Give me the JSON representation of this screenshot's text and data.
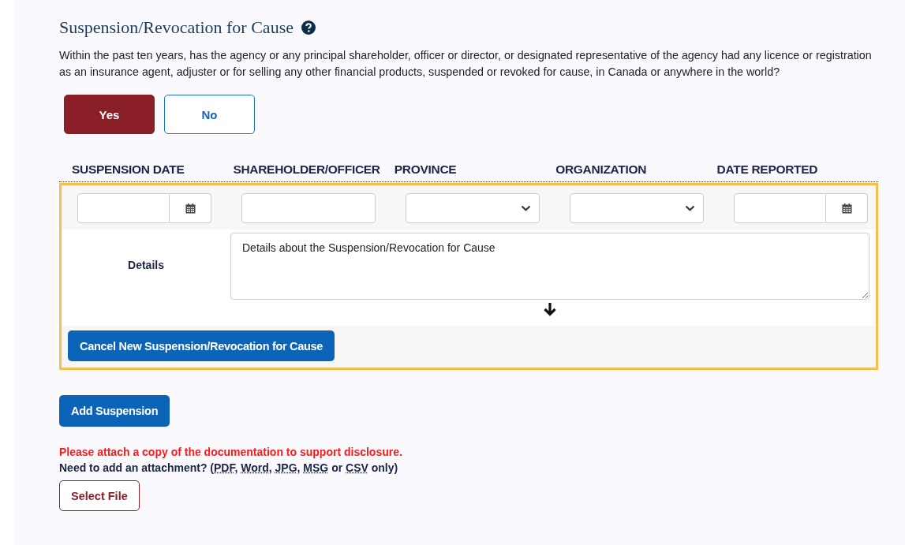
{
  "section": {
    "title": "Suspension/Revocation for Cause",
    "question": "Within the past ten years, has the agency or any principal shareholder, officer or director, or designated representative of the agency had any licence or registration as an insurance agent, adjuster or for selling any other financial products, suspended or revoked for cause, in Canada or anywhere in the world?"
  },
  "answers": [
    {
      "label": "Yes",
      "selected": true
    },
    {
      "label": "No",
      "selected": false
    }
  ],
  "table": {
    "columns": [
      {
        "heading": "SUSPENSION DATE",
        "kind": "date"
      },
      {
        "heading": "SHAREHOLDER/OFFICER",
        "kind": "text"
      },
      {
        "heading": "PROVINCE",
        "kind": "select"
      },
      {
        "heading": "ORGANIZATION",
        "kind": "select"
      },
      {
        "heading": "DATE REPORTED",
        "kind": "date"
      }
    ],
    "details_label": "Details",
    "details_value": "Details about the Suspension/Revocation for Cause",
    "cancel_button": "Cancel New Suspension/Revocation for Cause"
  },
  "add_button": "Add Suspension",
  "warning": "Please attach a copy of the documentation to support disclosure.",
  "attachment_note": [
    {
      "text": "Need to add an attachment? (",
      "abbr": false
    },
    {
      "text": "PDF",
      "abbr": true
    },
    {
      "text": ", ",
      "abbr": false
    },
    {
      "text": "Word",
      "abbr": true
    },
    {
      "text": ", ",
      "abbr": false
    },
    {
      "text": "JPG",
      "abbr": true
    },
    {
      "text": ", ",
      "abbr": false
    },
    {
      "text": "MSG",
      "abbr": true
    },
    {
      "text": " or ",
      "abbr": false
    },
    {
      "text": "CSV",
      "abbr": true
    },
    {
      "text": " only)",
      "abbr": false
    }
  ],
  "select_file_button": "Select File"
}
